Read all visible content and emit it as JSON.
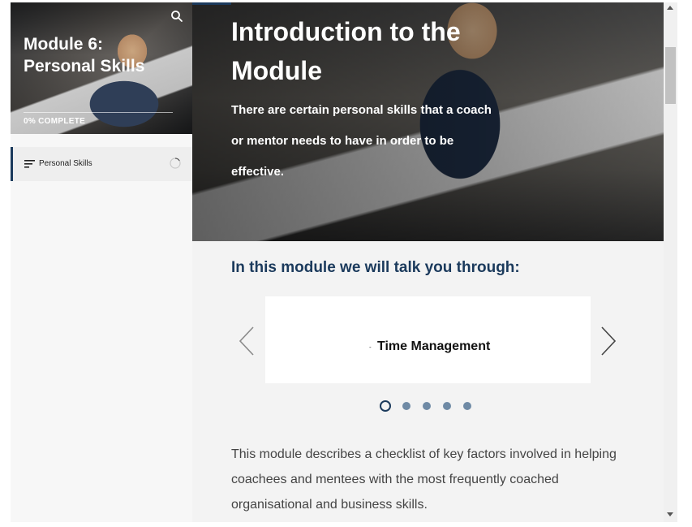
{
  "sidebar": {
    "module_title": "Module 6: Personal Skills",
    "progress_label": "0% COMPLETE",
    "progress_value": 0,
    "search_icon": "search-icon",
    "lessons": [
      {
        "label": "Personal Skills",
        "icon": "menu-lines-icon",
        "status_icon": "progress-ring-icon"
      }
    ]
  },
  "hero": {
    "title": "Introduction to the Module",
    "text": "There are certain personal skills that a coach or mentor needs to have in order to be effective."
  },
  "content": {
    "subheading": "In this module we will talk you through:",
    "carousel": {
      "items": [
        "Time Management"
      ],
      "bullet": "-",
      "total_slides": 5,
      "active_index": 0,
      "prev_icon": "chevron-left-icon",
      "next_icon": "chevron-right-icon"
    },
    "description": "This module describes a checklist of key factors involved in helping coachees and mentees with the most frequently coached organisational and business skills."
  },
  "colors": {
    "accent": "#1b3a5c",
    "dot_inactive": "#6f8aa5",
    "page_bg": "#f3f3f3"
  }
}
